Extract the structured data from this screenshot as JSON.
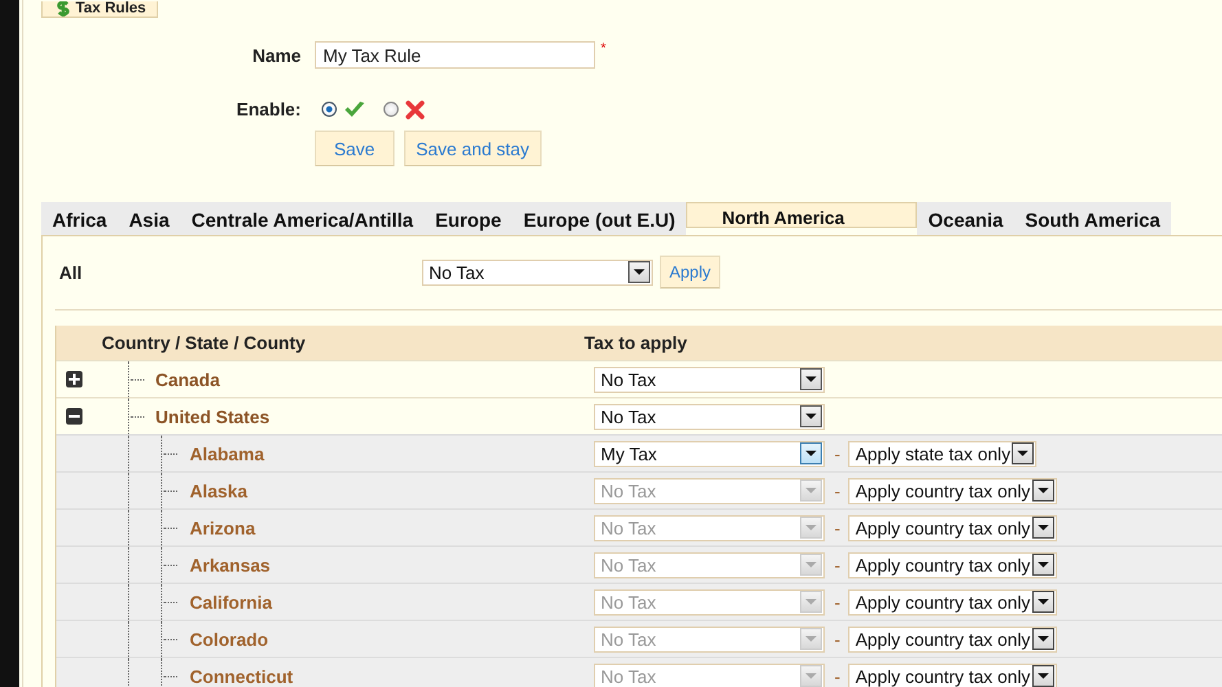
{
  "section_tab": {
    "label": "Tax Rules"
  },
  "form": {
    "name_label": "Name",
    "name_value": "My Tax Rule",
    "required_mark": "*",
    "enable_label": "Enable:",
    "enable_options": [
      {
        "kind": "yes",
        "selected": true
      },
      {
        "kind": "no",
        "selected": false
      }
    ],
    "buttons": [
      "Save",
      "Save and stay"
    ]
  },
  "tabs": [
    {
      "label": "Africa",
      "selected": false
    },
    {
      "label": "Asia",
      "selected": false
    },
    {
      "label": "Centrale America/Antilla",
      "selected": false
    },
    {
      "label": "Europe",
      "selected": false
    },
    {
      "label": "Europe (out E.U)",
      "selected": false
    },
    {
      "label": "North America",
      "selected": true
    },
    {
      "label": "Oceania",
      "selected": false
    },
    {
      "label": "South America",
      "selected": false
    }
  ],
  "all_row": {
    "label": "All",
    "value": "No Tax",
    "button": "Apply"
  },
  "table": {
    "columns": [
      "Country / State / County",
      "Tax to apply"
    ],
    "separator": "-",
    "rows": [
      {
        "name": "Canada",
        "expanded": false,
        "tax": "No Tax",
        "disabled": false
      },
      {
        "name": "United States",
        "expanded": true,
        "tax": "No Tax",
        "disabled": false,
        "children": [
          {
            "name": "Alabama",
            "tax": "My Tax",
            "disabled": false,
            "focused": true,
            "behavior": "Apply state tax only"
          },
          {
            "name": "Alaska",
            "tax": "No Tax",
            "disabled": true,
            "focused": false,
            "behavior": "Apply country tax only"
          },
          {
            "name": "Arizona",
            "tax": "No Tax",
            "disabled": true,
            "focused": false,
            "behavior": "Apply country tax only"
          },
          {
            "name": "Arkansas",
            "tax": "No Tax",
            "disabled": true,
            "focused": false,
            "behavior": "Apply country tax only"
          },
          {
            "name": "California",
            "tax": "No Tax",
            "disabled": true,
            "focused": false,
            "behavior": "Apply country tax only"
          },
          {
            "name": "Colorado",
            "tax": "No Tax",
            "disabled": true,
            "focused": false,
            "behavior": "Apply country tax only"
          },
          {
            "name": "Connecticut",
            "tax": "No Tax",
            "disabled": true,
            "focused": false,
            "behavior": "Apply country tax only"
          }
        ]
      }
    ]
  }
}
